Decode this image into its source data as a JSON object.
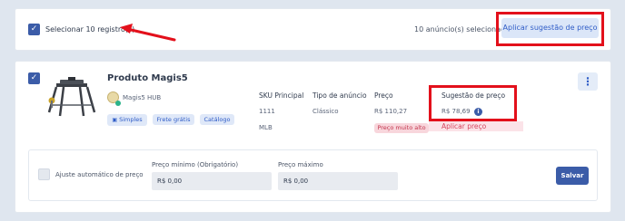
{
  "selection_bar": {
    "select_label": "Selecionar 10 registro(s)",
    "selected_count": "10 anúncio(s) selecionado(s)",
    "apply_button": "Aplicar sugestão de preço"
  },
  "product": {
    "title": "Produto Magis5",
    "store_name": "Magis5 HUB",
    "tags": [
      "Simples",
      "Frete grátis",
      "Catálogo"
    ],
    "sku_header": "SKU Principal",
    "sku_value": "1111",
    "marketplace": "MLB",
    "listing_type_header": "Tipo de anúncio",
    "listing_type_value": "Clássico",
    "price_header": "Preço",
    "price_value": "R$ 110,27",
    "price_badge": "Preço muito alto",
    "suggestion_header": "Sugestão de preço",
    "suggestion_value": "R$ 78,69",
    "apply_price_link": "Aplicar preço",
    "more_menu_icon": "kebab-icon",
    "info_icon_glyph": "i"
  },
  "price_settings": {
    "auto_adjust_label": "Ajuste automático de preço",
    "min_price_label": "Preço mínimo (Obrigatório)",
    "min_price_value": "R$ 0,00",
    "max_price_label": "Preço máximo",
    "max_price_value": "R$ 0,00",
    "save_button": "Salvar"
  },
  "colors": {
    "annotation_red": "#e3101b",
    "primary_blue": "#3b5ca8",
    "background": "#dfe6ef"
  }
}
